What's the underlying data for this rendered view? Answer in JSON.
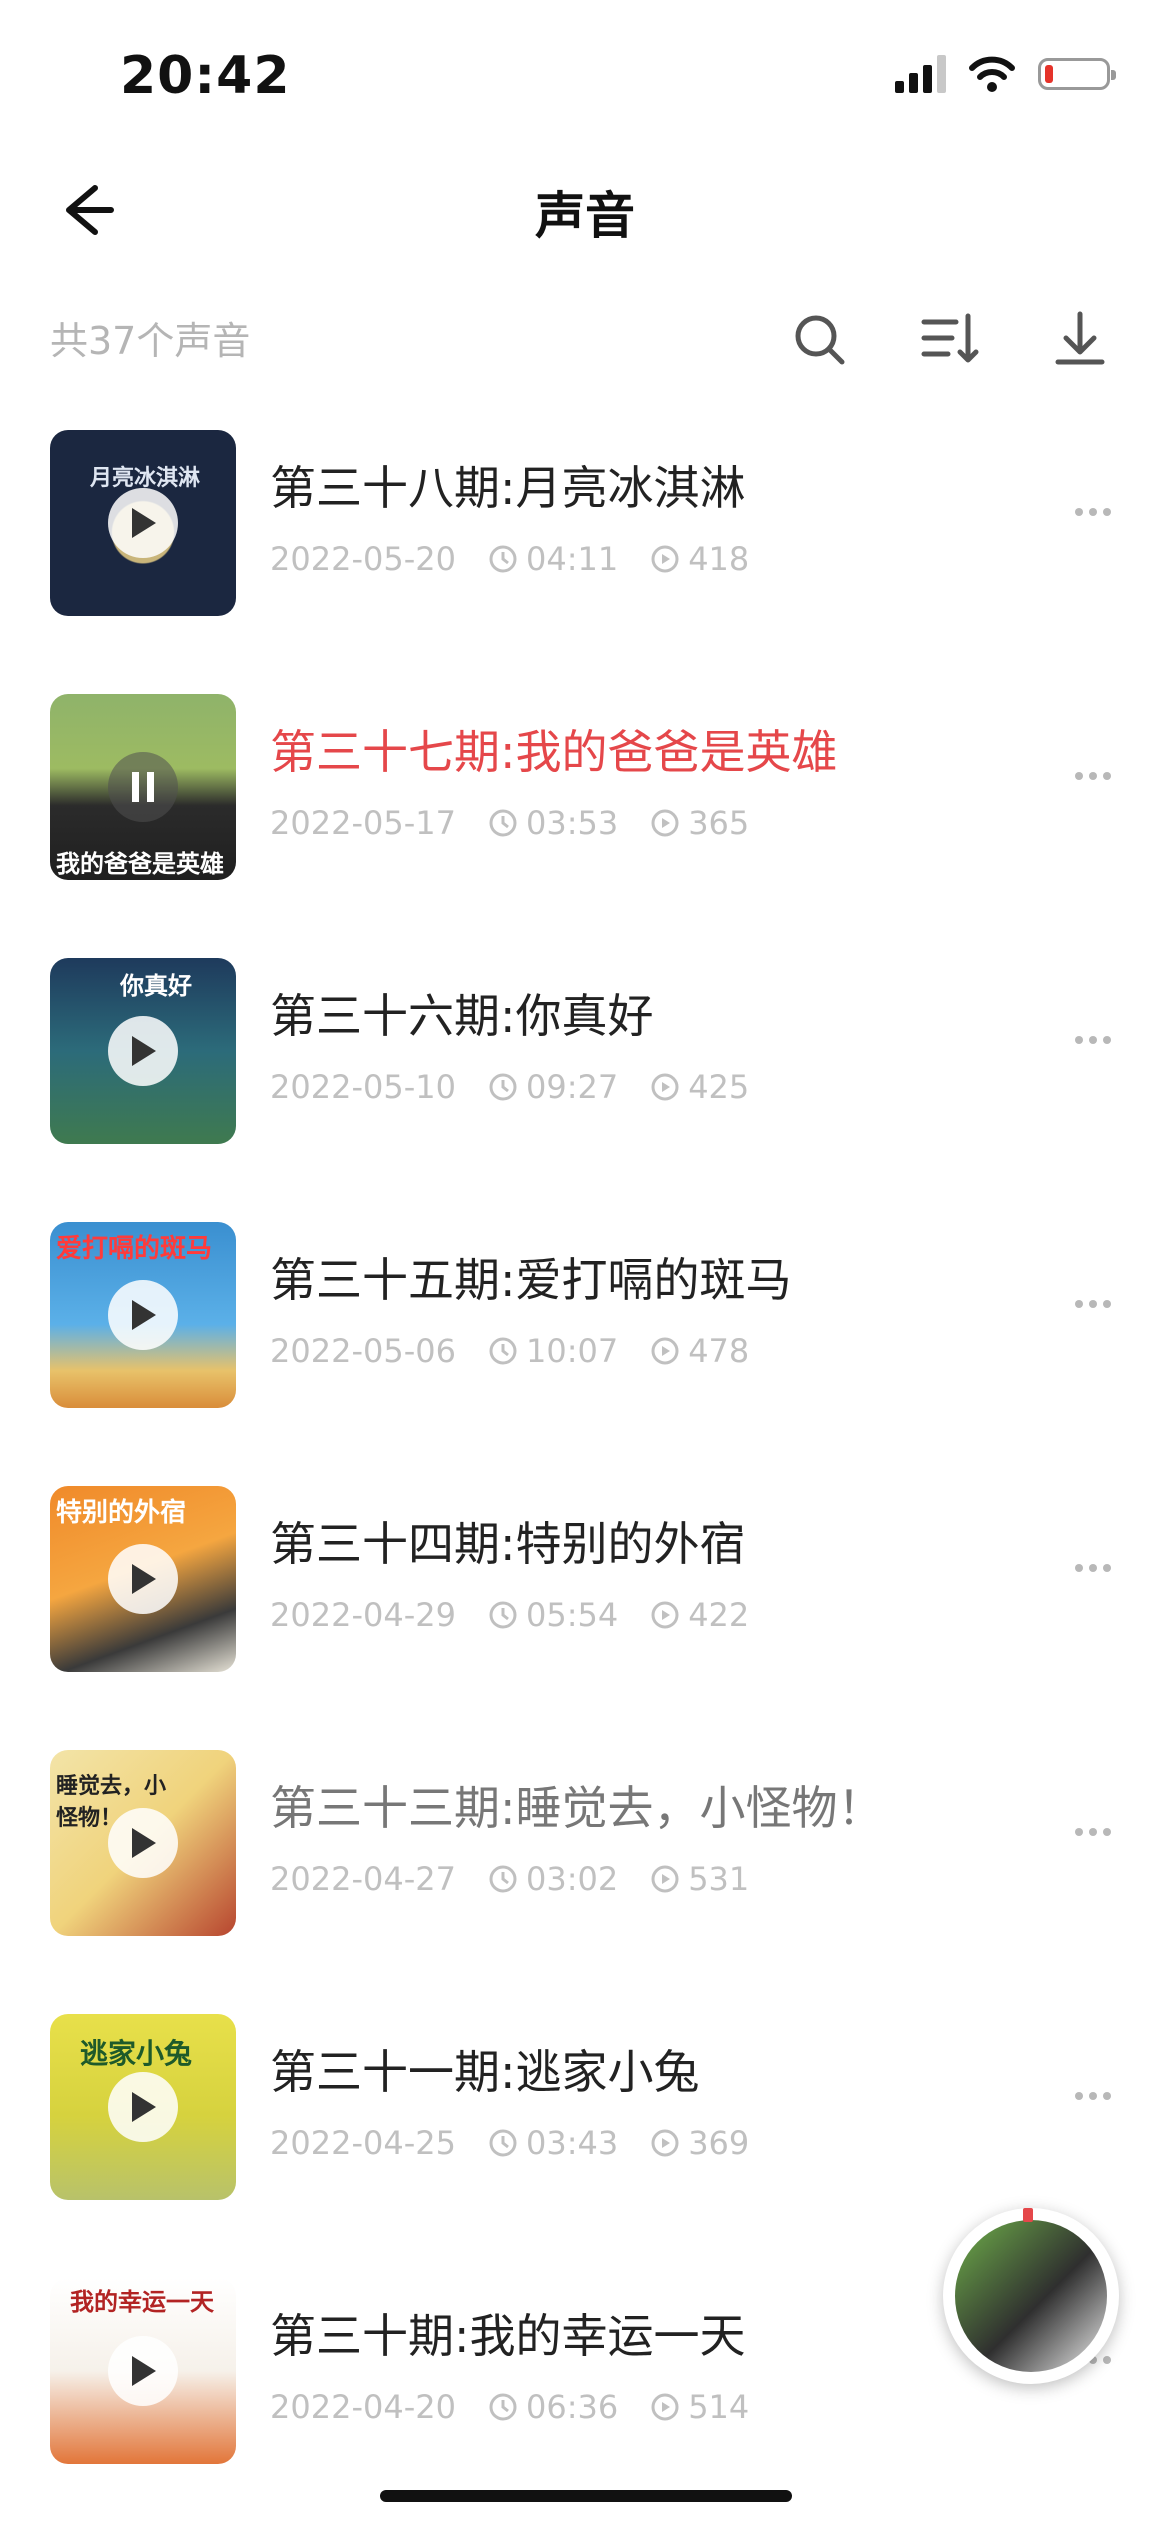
{
  "status": {
    "time": "20:42"
  },
  "nav": {
    "title": "声音"
  },
  "toolbar": {
    "count_text": "共37个声音"
  },
  "items": [
    {
      "title": "第三十八期:月亮冰淇淋",
      "date": "2022-05-20",
      "duration": "04:11",
      "plays": "418",
      "cover_text": "月亮冰淇淋",
      "state": "normal"
    },
    {
      "title": "第三十七期:我的爸爸是英雄",
      "date": "2022-05-17",
      "duration": "03:53",
      "plays": "365",
      "cover_text": "我的爸爸是英雄",
      "state": "playing"
    },
    {
      "title": "第三十六期:你真好",
      "date": "2022-05-10",
      "duration": "09:27",
      "plays": "425",
      "cover_text": "你真好",
      "state": "normal"
    },
    {
      "title": "第三十五期:爱打嗝的斑马",
      "date": "2022-05-06",
      "duration": "10:07",
      "plays": "478",
      "cover_text": "爱打嗝的斑马",
      "state": "normal"
    },
    {
      "title": "第三十四期:特别的外宿",
      "date": "2022-04-29",
      "duration": "05:54",
      "plays": "422",
      "cover_text": "特别的外宿",
      "state": "normal"
    },
    {
      "title": "第三十三期:睡觉去，小怪物！",
      "date": "2022-04-27",
      "duration": "03:02",
      "plays": "531",
      "cover_text": "睡觉去，小怪物！",
      "state": "played"
    },
    {
      "title": "第三十一期:逃家小兔",
      "date": "2022-04-25",
      "duration": "03:43",
      "plays": "369",
      "cover_text": "逃家小兔",
      "state": "normal"
    },
    {
      "title": "第三十期:我的幸运一天",
      "date": "2022-04-20",
      "duration": "06:36",
      "plays": "514",
      "cover_text": "我的幸运一天",
      "state": "normal"
    }
  ],
  "colors": {
    "active": "#e5474a",
    "meta": "#c0c0c0"
  }
}
